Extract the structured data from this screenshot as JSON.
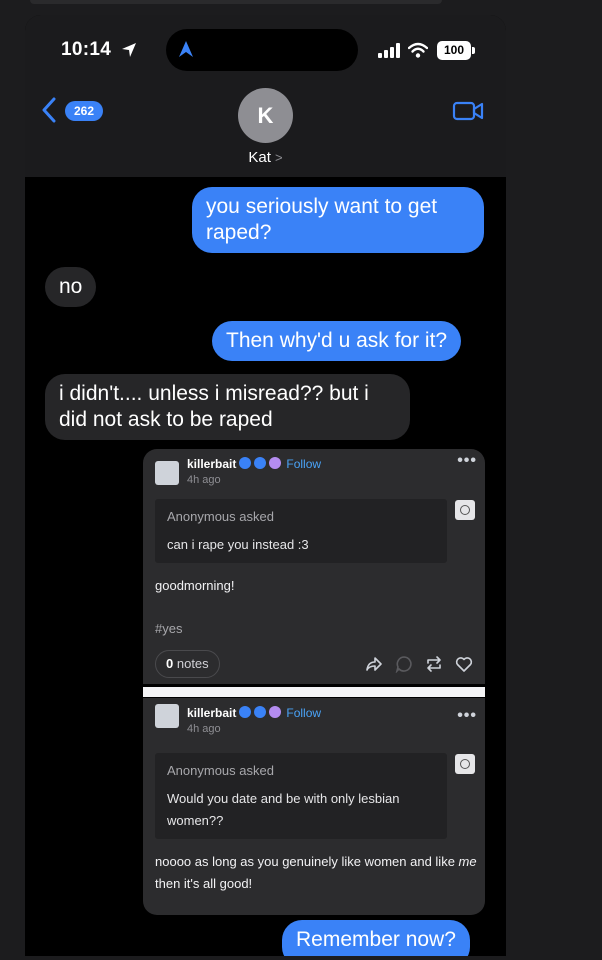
{
  "status_bar": {
    "time": "10:14",
    "battery": "100",
    "location_icon": "location-arrow-icon",
    "signal_icon": "cellular-signal-icon",
    "wifi_icon": "wifi-icon"
  },
  "nav": {
    "unread_count": "262",
    "contact_initial": "K",
    "contact_name": "Kat",
    "chevron": ">",
    "back_icon": "chevron-left-icon",
    "video_icon": "video-camera-icon"
  },
  "colors": {
    "sent_bubble": "#3a82f7",
    "received_bubble": "#262628",
    "background": "#000000",
    "tumblr_card": "#2c2c2e"
  },
  "messages": [
    {
      "from": "me",
      "text": "you seriously want to get raped?"
    },
    {
      "from": "them",
      "text": "no"
    },
    {
      "from": "me",
      "text": "Then why'd u ask for it?"
    },
    {
      "from": "them",
      "text": "i didn't.... unless i misread?? but i did not ask to be raped"
    },
    {
      "from": "me",
      "text": "Remember now?"
    }
  ],
  "screenshot_posts": [
    {
      "username": "killerbait",
      "follow_label": "Follow",
      "time_ago": "4h ago",
      "more": "•••",
      "asker": "Anonymous",
      "asked_label": "asked",
      "question": "can i rape you instead :3",
      "answer": "goodmorning!",
      "tag": "#yes",
      "notes_count": "0",
      "notes_label": "notes",
      "actions": [
        "share-icon",
        "reply-icon",
        "reblog-icon",
        "heart-icon"
      ]
    },
    {
      "username": "killerbait",
      "follow_label": "Follow",
      "time_ago": "4h ago",
      "more": "•••",
      "asker": "Anonymous",
      "asked_label": "asked",
      "question": "Would you date and be with only lesbian women??",
      "answer_part1": "noooo as long as you genuinely like women and like ",
      "answer_emphasis": "me",
      "answer_part2": " then it's all good!"
    }
  ]
}
